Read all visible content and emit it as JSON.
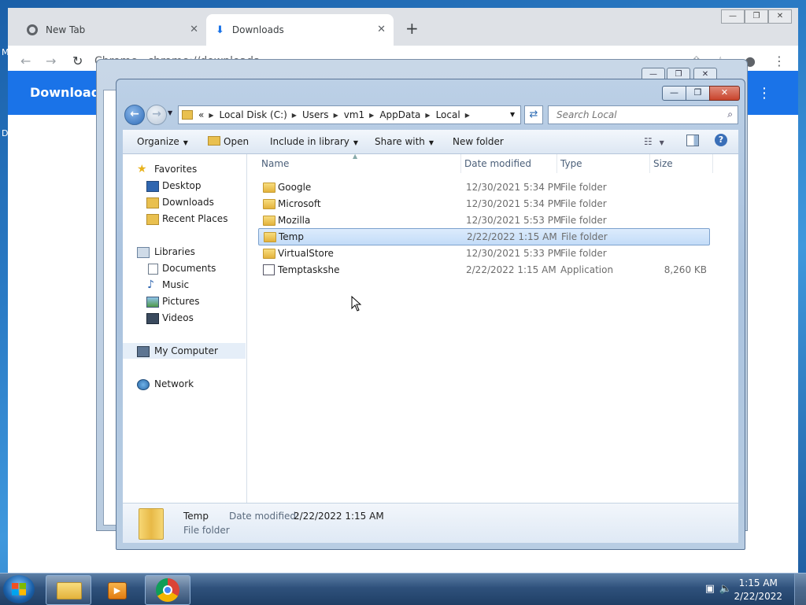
{
  "desktop": {
    "left_letters": [
      "M",
      "D"
    ]
  },
  "chrome": {
    "tabs": [
      {
        "label": "New Tab",
        "icon": "chrome-icon",
        "active": false
      },
      {
        "label": "Downloads",
        "icon": "download-icon",
        "active": true
      }
    ],
    "omnibox": {
      "site": "Chrome",
      "url": "chrome://downloads"
    },
    "page_title": "Downloads"
  },
  "explorer": {
    "address": {
      "overflow": "«",
      "segments": [
        "Local Disk (C:)",
        "Users",
        "vm1",
        "AppData",
        "Local"
      ]
    },
    "search": {
      "placeholder": "Search Local"
    },
    "commands": {
      "organize": "Organize",
      "open": "Open",
      "include": "Include in library",
      "share": "Share with",
      "newfolder": "New folder"
    },
    "nav": {
      "favorites": "Favorites",
      "desktop": "Desktop",
      "downloads": "Downloads",
      "recent": "Recent Places",
      "libraries": "Libraries",
      "documents": "Documents",
      "music": "Music",
      "pictures": "Pictures",
      "videos": "Videos",
      "mycomputer": "My Computer",
      "network": "Network"
    },
    "columns": {
      "name": "Name",
      "date": "Date modified",
      "type": "Type",
      "size": "Size"
    },
    "files": [
      {
        "name": "Google",
        "date": "12/30/2021 5:34 PM",
        "type": "File folder",
        "size": ""
      },
      {
        "name": "Microsoft",
        "date": "12/30/2021 5:34 PM",
        "type": "File folder",
        "size": ""
      },
      {
        "name": "Mozilla",
        "date": "12/30/2021 5:53 PM",
        "type": "File folder",
        "size": ""
      },
      {
        "name": "Temp",
        "date": "2/22/2022 1:15 AM",
        "type": "File folder",
        "size": ""
      },
      {
        "name": "VirtualStore",
        "date": "12/30/2021 5:33 PM",
        "type": "File folder",
        "size": ""
      },
      {
        "name": "Temptaskshe",
        "date": "2/22/2022 1:15 AM",
        "type": "Application",
        "size": "8,260 KB"
      }
    ],
    "selected_index": 3,
    "details": {
      "name": "Temp",
      "type": "File folder",
      "modified_label": "Date modified:",
      "modified_value": "2/22/2022 1:15 AM"
    }
  },
  "taskbar": {
    "time": "1:15 AM",
    "date": "2/22/2022"
  }
}
